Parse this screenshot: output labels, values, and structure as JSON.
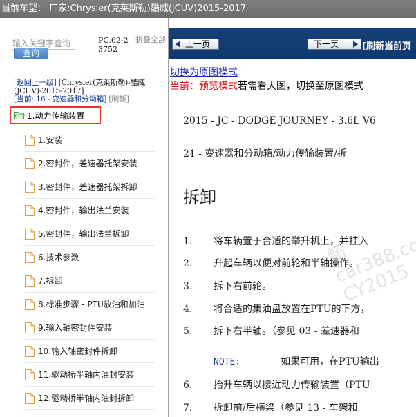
{
  "titlebar": {
    "text": "当前车型：  厂家:Chrysler(克莱斯勒)酷威(JCUV)2015-2017"
  },
  "left_panel": {
    "search_placeholder": "输入关键字查询",
    "query_label": "查询",
    "pc_code": "PC.62-23752",
    "collapse_all_label": "折叠全部",
    "breadcrumb": {
      "back_label": "[返回上一级]",
      "path_label": "[Chrysler(克莱斯勒)-酷威(JCUV)-2015-2017]"
    },
    "current_prefix": "[当前: ",
    "current_label": "16 - 变速器和分动箱",
    "current_suffix": "]",
    "refresh_label": "[刷新]",
    "tree_root_label": "1.动力传输装置",
    "tree_items": [
      {
        "label": "1.安装"
      },
      {
        "label": "2.密封件，差速器托架安装"
      },
      {
        "label": "3.密封件，差速器托架拆卸"
      },
      {
        "label": "4.密封件，输出法兰安装"
      },
      {
        "label": "5.密封件，输出法兰拆卸"
      },
      {
        "label": "6.技术参数"
      },
      {
        "label": "7.拆卸"
      },
      {
        "label": "8.标准步骤 - PTU放油和加油"
      },
      {
        "label": "9.输入轴密封件安装"
      },
      {
        "label": "10.输入轴密封件拆卸"
      },
      {
        "label": "11.驱动桥半轴内油封安装"
      },
      {
        "label": "12.驱动桥半轴内油封拆卸"
      }
    ]
  },
  "right_panel": {
    "prev_label": "上一页",
    "next_label": "下一页",
    "refresh_link": "[刷新当前页",
    "switch_mode_link": "切换为原图模式",
    "mode_prefix": "当前：预览模式",
    "mode_suffix": "若需看大图，切换至原图模式",
    "doc_title": "2015 - JC - DODGE JOURNEY - 3.6L V6",
    "doc_subtitle": "21 - 变速器和分动箱/动力传输装置/拆",
    "doc_heading": "拆卸",
    "steps": [
      {
        "num": "1.",
        "text": "将车辆置于合适的举升机上，并挂入"
      },
      {
        "num": "2.",
        "text": "升起车辆以便对前轮和半轴操作。"
      },
      {
        "num": "3.",
        "text": "拆下右前轮。"
      },
      {
        "num": "4.",
        "text": "将合适的集油盘放置在PTU的下方，"
      },
      {
        "num": "5.",
        "text": "拆下右半轴。（参见 03 - 差速器和"
      }
    ],
    "note_label": "NOTE:",
    "note_text": "如果可用，在PTU输出",
    "steps2": [
      {
        "num": "6.",
        "text": "抬升车辆以接近动力传输装置（PTU"
      },
      {
        "num": "7.",
        "text": "拆卸前/后横梁（参见 13 - 车架和"
      }
    ],
    "watermark_lines": [
      "畅",
      "car388.co",
      "CY2015"
    ]
  },
  "colors": {
    "titlebar_bg": "#737373",
    "toolbar_bg": "#123d72",
    "highlight_border": "#e0362a",
    "link_blue": "#1a2fa8",
    "mode_red": "#dd1111"
  }
}
